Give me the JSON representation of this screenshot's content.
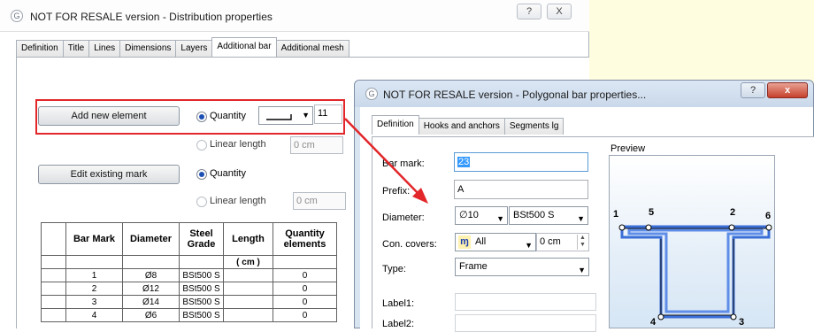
{
  "main_dialog": {
    "title": "NOT FOR RESALE version - Distribution properties",
    "help_label": "?",
    "close_label": "X",
    "tabs": [
      "Definition",
      "Title",
      "Lines",
      "Dimensions",
      "Layers",
      "Additional bar",
      "Additional mesh"
    ],
    "active_tab": "Additional bar",
    "add_new_element_label": "Add new element",
    "quantity_label": "Quantity",
    "quantity_value": "11",
    "linear_length_label": "Linear length",
    "linear_length_value": "0 cm",
    "edit_existing_mark_label": "Edit existing mark",
    "quantity2_label": "Quantity",
    "linear_length2_label": "Linear length",
    "linear_length2_value": "0 cm",
    "table": {
      "headers": [
        "",
        "Bar Mark",
        "Diameter",
        "Steel Grade",
        "Length",
        "Quantity elements"
      ],
      "units_row": [
        "",
        "",
        "",
        "",
        "( cm )",
        ""
      ],
      "rows": [
        [
          "",
          "1",
          "Ø8",
          "BSt500 S",
          "",
          "0"
        ],
        [
          "",
          "2",
          "Ø12",
          "BSt500 S",
          "",
          "0"
        ],
        [
          "",
          "3",
          "Ø14",
          "BSt500 S",
          "",
          "0"
        ],
        [
          "",
          "4",
          "Ø6",
          "BSt500 S",
          "",
          "0"
        ]
      ]
    }
  },
  "bar_dialog": {
    "title": "NOT FOR RESALE version - Polygonal bar properties...",
    "help_label": "?",
    "close_label": "x",
    "tabs": [
      "Definition",
      "Hooks and anchors",
      "Segments lg"
    ],
    "active_tab": "Definition",
    "bar_mark_label": "Bar mark:",
    "bar_mark_value": "23",
    "prefix_label": "Prefix:",
    "prefix_value": "A",
    "diameter_label": "Diameter:",
    "diameter_value": "∅10",
    "steel_grade_value": "BSt500 S",
    "con_covers_label": "Con. covers:",
    "con_covers_value": "All",
    "con_covers_cm": "0 cm",
    "type_label": "Type:",
    "type_value": "Frame",
    "label1": "Label1:",
    "label2": "Label2:",
    "preview_label": "Preview",
    "preview_points": [
      "1",
      "5",
      "2",
      "6",
      "4",
      "3"
    ]
  },
  "colors": {
    "highlight": "#e2262a",
    "bar_shape": "#3a6fd8",
    "title_accent": "#c6402c"
  }
}
